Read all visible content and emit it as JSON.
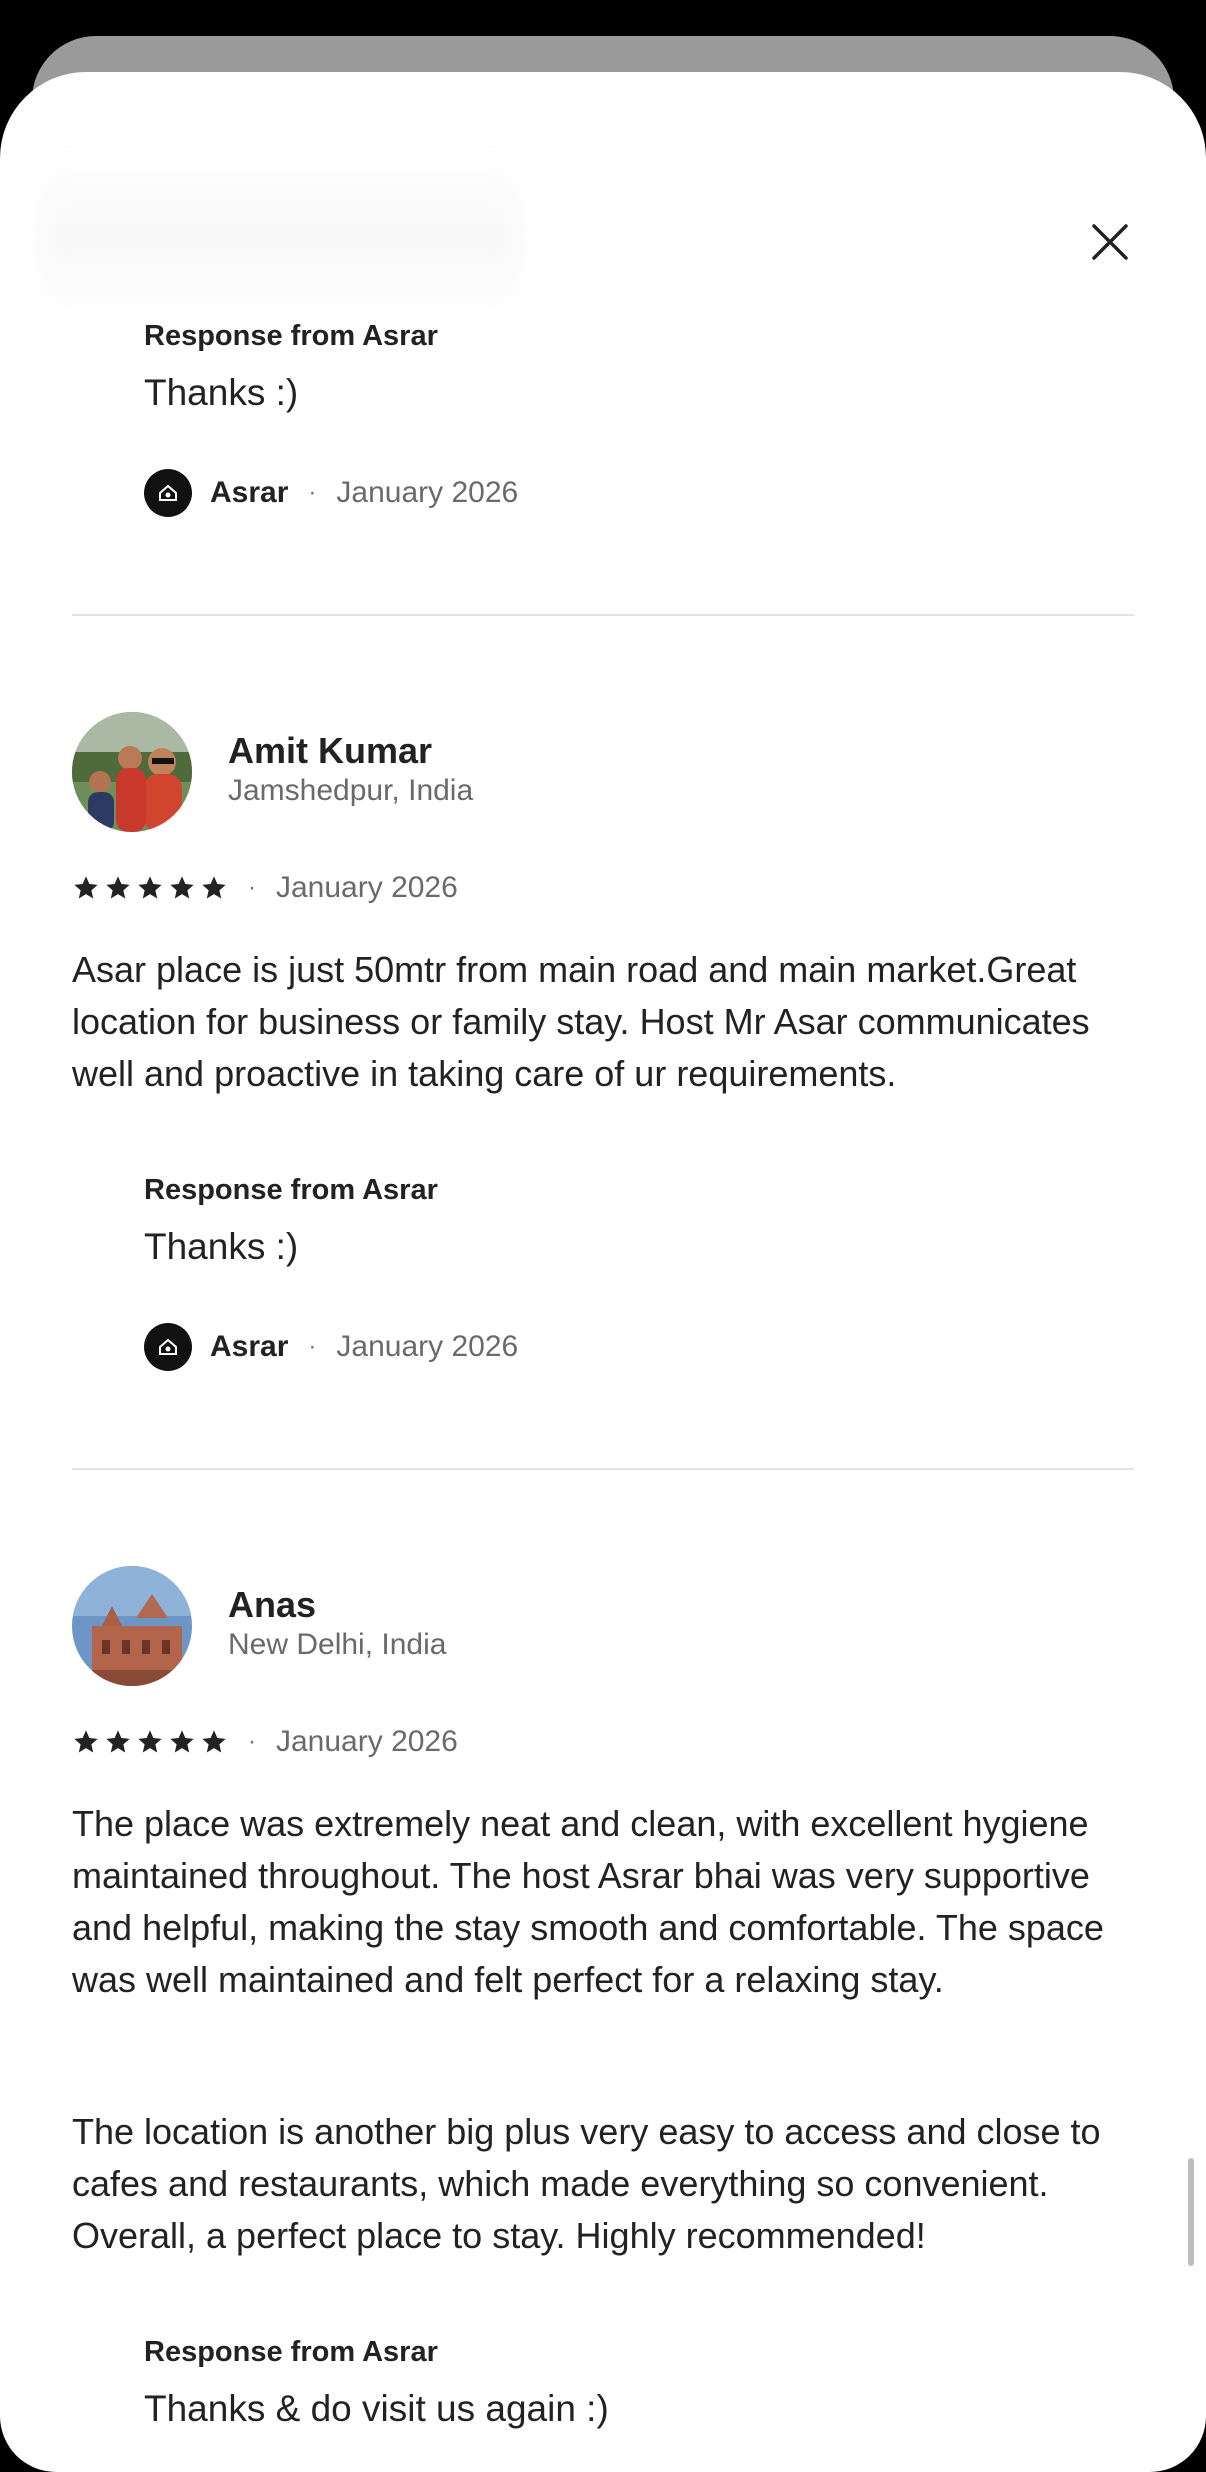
{
  "close_label": "close",
  "entries": [
    {
      "response": {
        "title": "Response from Asrar",
        "text": "Thanks :)",
        "host": "Asrar",
        "date": "January 2026"
      }
    },
    {
      "reviewer": {
        "name": "Amit Kumar",
        "location": "Jamshedpur, India",
        "rating": 5,
        "date": "January 2026",
        "body": "Asar place is just 50mtr from main road and main market.Great location for business or family stay. Host Mr Asar communicates well and proactive in taking care of ur requirements."
      },
      "response": {
        "title": "Response from Asrar",
        "text": "Thanks :)",
        "host": "Asrar",
        "date": "January 2026"
      }
    },
    {
      "reviewer": {
        "name": "Anas",
        "location": "New Delhi, India",
        "rating": 5,
        "date": "January 2026",
        "body_p1": "The place was extremely neat and clean, with excellent hygiene maintained throughout. The host Asrar bhai was very supportive and helpful, making the stay smooth and comfortable. The space was well maintained and felt perfect for a relaxing stay.",
        "body_p2": "The location is another big plus very easy to access and close to cafes and restaurants, which made everything so convenient. Overall, a perfect place to stay. Highly recommended!"
      },
      "response": {
        "title": "Response from Asrar",
        "text": "Thanks & do visit us again :)"
      }
    }
  ],
  "separator": "·",
  "colors": {
    "text": "#222222",
    "secondary": "#6a6a6a",
    "divider": "#e4e4e4"
  },
  "icons": {
    "close": "close-icon",
    "star": "star-icon",
    "host_logo": "host-logo-icon"
  }
}
